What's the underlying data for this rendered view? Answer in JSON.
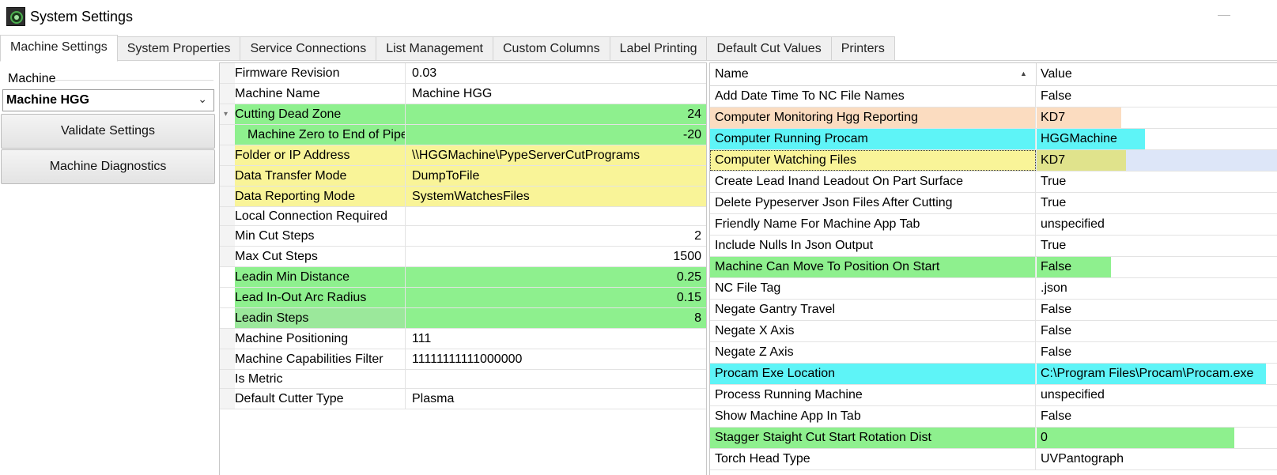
{
  "window": {
    "title": "System Settings",
    "icon": "app-logo-icon"
  },
  "tabs": [
    {
      "label": "Machine Settings",
      "active": true
    },
    {
      "label": "System Properties"
    },
    {
      "label": "Service Connections"
    },
    {
      "label": "List Management"
    },
    {
      "label": "Custom Columns"
    },
    {
      "label": "Label Printing"
    },
    {
      "label": "Default Cut Values"
    },
    {
      "label": "Printers"
    }
  ],
  "left_panel": {
    "machine_label": "Machine",
    "machine_selected": "Machine HGG",
    "validate_button": "Validate Settings",
    "diagnostics_button": "Machine Diagnostics"
  },
  "properties": [
    {
      "name": "Firmware Revision",
      "value": "0.03"
    },
    {
      "name": "Machine Name",
      "value": "Machine HGG"
    },
    {
      "name": "Cutting Dead Zone",
      "value": "24",
      "highlight": "#8ef08e",
      "expanded": true
    },
    {
      "name": "Machine Zero to End of Pipe",
      "value": "-20",
      "highlight": "#8ef08e"
    },
    {
      "name": "Folder or IP Address",
      "value": "\\\\HGGMachine\\PypeServerCutPrograms",
      "highlight": "#f9f498"
    },
    {
      "name": "Data Transfer Mode",
      "value": "DumpToFile",
      "highlight": "#f9f498"
    },
    {
      "name": "Data Reporting Mode",
      "value": "SystemWatchesFiles",
      "highlight": "#f9f498"
    },
    {
      "name": "Local Connection Required",
      "checked": false
    },
    {
      "name": "Min Cut Steps",
      "value": "2"
    },
    {
      "name": "Max Cut Steps",
      "value": "1500"
    },
    {
      "name": "Leadin Min Distance",
      "value": "0.25",
      "highlight": "#8ef08e"
    },
    {
      "name": "Lead In-Out Arc Radius",
      "value": "0.15",
      "highlight": "#8ef08e"
    },
    {
      "name": "Leadin Steps",
      "value": "8",
      "highlight": "#8ef08e"
    },
    {
      "name": "Machine Positioning",
      "value": "111"
    },
    {
      "name": "Machine Capabilities Filter",
      "value": "11111111111000000"
    },
    {
      "name": "Is Metric",
      "checked": false
    },
    {
      "name": "Default Cutter Type",
      "value": "Plasma"
    }
  ],
  "right_grid": {
    "header_name": "Name",
    "header_value": "Value",
    "sort": "ascending",
    "rows": [
      {
        "name": "Add Date Time To NC File Names",
        "value": "False"
      },
      {
        "name": "Computer Monitoring Hgg Reporting",
        "value": "KD7",
        "highlight": "#fbdcc0"
      },
      {
        "name": "Computer Running Procam",
        "value": "HGGMachine",
        "highlight": "#5ef4f7"
      },
      {
        "name": "Computer Watching Files",
        "value": "KD7",
        "highlight": "#f9f498",
        "selected": true
      },
      {
        "name": "Create Lead Inand Leadout On Part Surface",
        "value": "True"
      },
      {
        "name": "Delete Pypeserver Json Files After Cutting",
        "value": "True"
      },
      {
        "name": "Friendly Name For Machine App Tab",
        "value": "unspecified"
      },
      {
        "name": "Include Nulls In Json Output",
        "value": "True"
      },
      {
        "name": "Machine Can Move To Position On Start",
        "value": "False",
        "highlight": "#8ef08e"
      },
      {
        "name": "NC File Tag",
        "value": ".json"
      },
      {
        "name": "Negate Gantry Travel",
        "value": "False"
      },
      {
        "name": "Negate X Axis",
        "value": "False"
      },
      {
        "name": "Negate Z Axis",
        "value": "False"
      },
      {
        "name": "Procam Exe Location",
        "value": "C:\\Program Files\\Procam\\Procam.exe",
        "highlight": "#5ef4f7"
      },
      {
        "name": "Process Running Machine",
        "value": "unspecified"
      },
      {
        "name": "Show Machine App In Tab",
        "value": "False"
      },
      {
        "name": "Stagger Staight Cut Start Rotation Dist",
        "value": "0",
        "highlight": "#8ef08e"
      },
      {
        "name": "Torch Head Type",
        "value": "UVPantograph"
      }
    ]
  }
}
